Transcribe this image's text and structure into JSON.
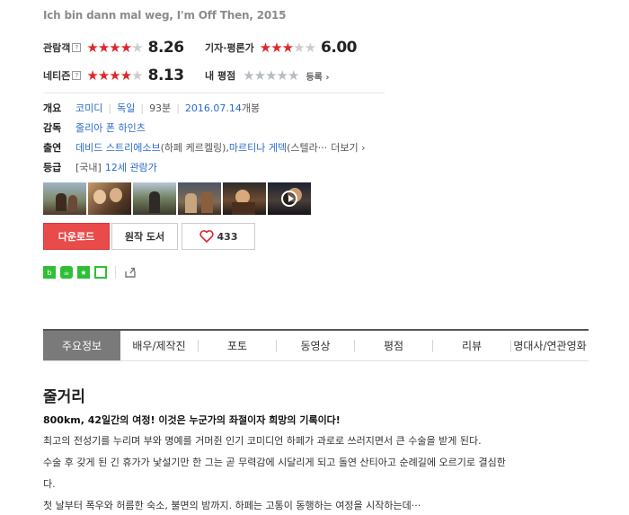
{
  "original_title": "Ich bin dann mal weg, I'm Off Then, 2015",
  "ratings": {
    "audience": {
      "label": "관람객",
      "help": "?",
      "score": "8.26",
      "stars_on": 4
    },
    "critics": {
      "label": "기자·평론가",
      "score": "6.00",
      "stars_on": 3
    },
    "netizen": {
      "label": "네티즌",
      "help": "?",
      "score": "8.13",
      "stars_on": 4
    },
    "mine": {
      "label": "내 평점",
      "register": "등록 ›"
    }
  },
  "info": {
    "overview": {
      "label": "개요",
      "genre": "코미디",
      "country": "독일",
      "runtime": "93분",
      "release_date": "2016.07.14",
      "release_suffix": "개봉"
    },
    "director": {
      "label": "감독",
      "name": "줄리아 폰 하인츠"
    },
    "cast": {
      "label": "출연",
      "actor1": "데비드 스트리에소브",
      "role1": "(하페 케르켈링), ",
      "actor2": "마르티나 게덱",
      "role2": "(스텔라··· ",
      "more": "더보기 ›"
    },
    "rating": {
      "label": "등급",
      "region": "[국내]",
      "grade": "12세 관람가"
    }
  },
  "thumbnails": [
    {
      "alt": "still-1"
    },
    {
      "alt": "still-2"
    },
    {
      "alt": "still-3"
    },
    {
      "alt": "still-4"
    },
    {
      "alt": "still-5"
    },
    {
      "alt": "trailer"
    }
  ],
  "buttons": {
    "download": "다운로드",
    "book": "원작 도서",
    "like_count": "433"
  },
  "tabs": [
    "주요정보",
    "배우/제작진",
    "포토",
    "동영상",
    "평점",
    "리뷰",
    "명대사/연관영화"
  ],
  "synopsis": {
    "title": "줄거리",
    "headline": "800km, 42일간의 여정! 이것은 누군가의 좌절이자 희망의 기록이다!",
    "lines": [
      "최고의 전성기를 누리며 부와 명예를 거머쥔 인기 코미디언 하페가 과로로 쓰러지면서 큰 수술을 받게 된다.",
      " 수술 후 갖게 된 긴 휴가가 낯설기만 한 그는 곧 무력감에 시달리게 되고 돌연 산티아고 순례길에 오르기로 결심한",
      "다.",
      " 첫 날부터 폭우와 허름한 숙소, 불면의 밤까지. 하페는 고통이 동행하는 여정을 시작하는데···"
    ]
  },
  "colors": {
    "accent_red": "#e0262b",
    "link_blue": "#2a6bc9",
    "active_tab": "#7a7a7a",
    "download_btn": "#e94b4b"
  }
}
